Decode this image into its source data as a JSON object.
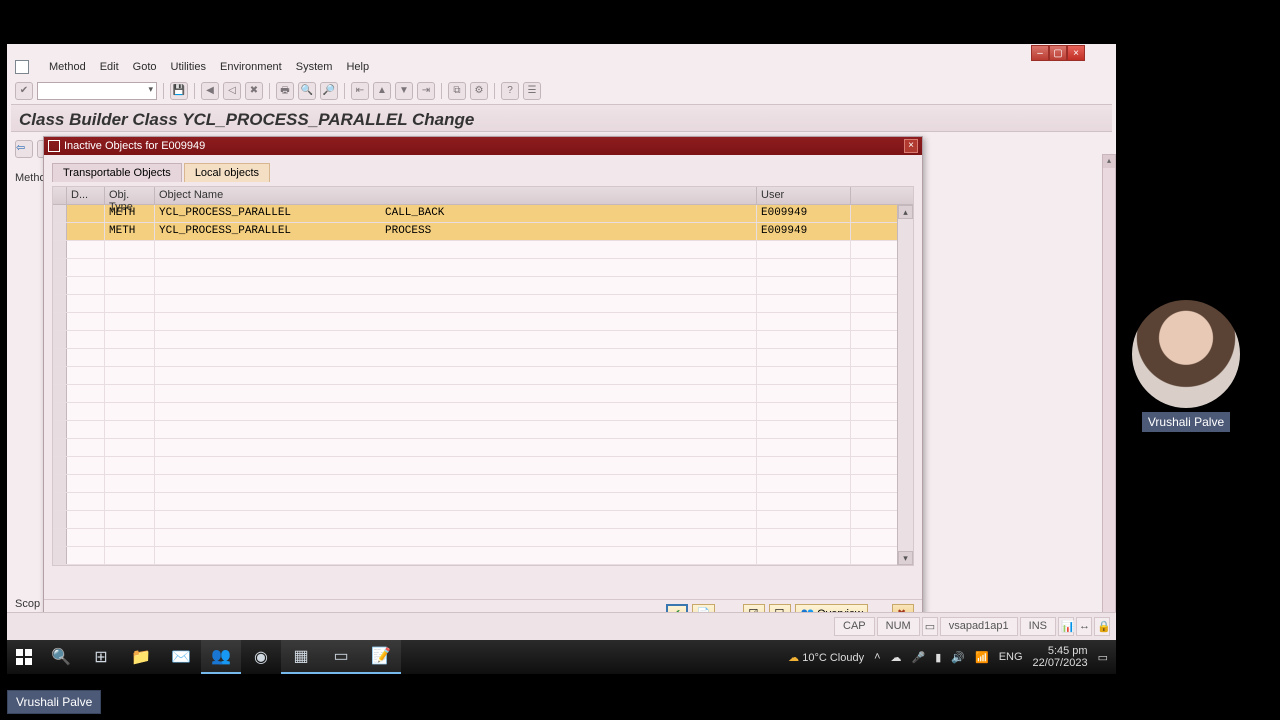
{
  "menu": {
    "items": [
      "Method",
      "Edit",
      "Goto",
      "Utilities",
      "Environment",
      "System",
      "Help"
    ]
  },
  "page_title": "Class Builder Class YCL_PROCESS_PARALLEL Change",
  "truncated": {
    "metho": "Metho",
    "scope": "Scop"
  },
  "dialog": {
    "title": "Inactive Objects for E009949",
    "tabs": {
      "transportable": "Transportable Objects",
      "local": "Local objects"
    },
    "columns": {
      "c0": "D...",
      "c1": "Obj. Type",
      "c2": "Object Name",
      "c3": "User"
    },
    "rows": [
      {
        "type": "METH",
        "name": "YCL_PROCESS_PARALLEL",
        "sub": "CALL_BACK",
        "user": "E009949"
      },
      {
        "type": "METH",
        "name": "YCL_PROCESS_PARALLEL",
        "sub": "PROCESS",
        "user": "E009949"
      }
    ],
    "footer": {
      "overview": "Overview"
    }
  },
  "status": {
    "cap": "CAP",
    "num": "NUM",
    "server": "vsapad1ap1",
    "mode": "INS"
  },
  "taskbar": {
    "weather": "10°C  Cloudy",
    "lang": "ENG",
    "time": "5:45 pm",
    "date": "22/07/2023"
  },
  "presenter": "Vrushali Palve"
}
